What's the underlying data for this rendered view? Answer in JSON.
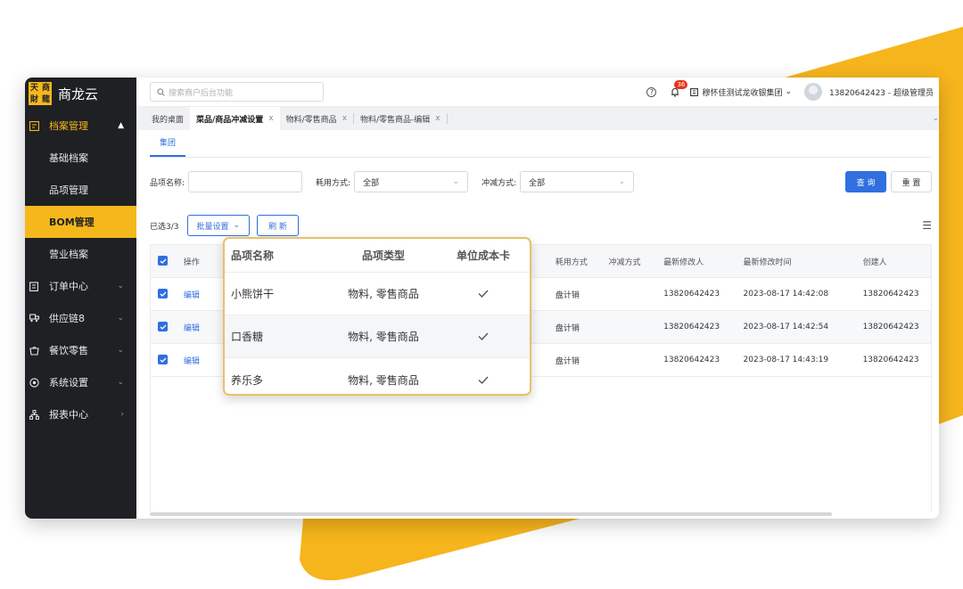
{
  "brand": {
    "logo_chars": [
      "天",
      "商",
      "財",
      "龍"
    ],
    "name": "商龙云"
  },
  "colors": {
    "accent": "#f5b81c",
    "primary": "#2f6fe0",
    "sidebar": "#1f2024",
    "badge": "#e8341c"
  },
  "sidebar": {
    "group": {
      "label": "档案管理",
      "icon": "archive-icon",
      "expanded": true
    },
    "subitems": [
      {
        "label": "基础档案",
        "active": false
      },
      {
        "label": "品项管理",
        "active": false
      },
      {
        "label": "BOM管理",
        "active": true
      },
      {
        "label": "营业档案",
        "active": false
      }
    ],
    "items": [
      {
        "label": "订单中心",
        "icon": "order-icon",
        "arrow": "chevron-down-icon"
      },
      {
        "label": "供应链8",
        "icon": "supply-chain-icon",
        "arrow": "chevron-down-icon"
      },
      {
        "label": "餐饮零售",
        "icon": "retail-icon",
        "arrow": "chevron-down-icon"
      },
      {
        "label": "系统设置",
        "icon": "settings-icon",
        "arrow": "chevron-down-icon"
      },
      {
        "label": "报表中心",
        "icon": "report-icon",
        "arrow": "chevron-right-icon"
      }
    ]
  },
  "topbar": {
    "search_placeholder": "搜索商户后台功能",
    "notification_count": "36",
    "org_name": "穆怀佳测试龙收银集团",
    "user": "13820642423 - 超级管理员"
  },
  "tabs": [
    {
      "label": "我的桌面",
      "active": false,
      "closable": false
    },
    {
      "label": "菜品/商品冲减设置",
      "active": true,
      "closable": true
    },
    {
      "label": "物料/零售商品",
      "active": false,
      "closable": true
    },
    {
      "label": "物料/零售商品-编辑",
      "active": false,
      "closable": true
    }
  ],
  "subtab": "集团",
  "filters": {
    "item_name_label": "品项名称:",
    "consumption_label": "耗用方式:",
    "consumption_value": "全部",
    "offset_label": "冲减方式:",
    "offset_value": "全部",
    "query_label": "查 询",
    "reset_label": "重 置"
  },
  "actions": {
    "selected_text": "已选3/3",
    "batch_label": "批量设置",
    "refresh_label": "刷 新"
  },
  "table": {
    "headers": {
      "op": "操作",
      "consumption": "耗用方式",
      "offset": "冲减方式",
      "modifier": "最新修改人",
      "mod_time": "最新修改时间",
      "creator": "创建人"
    },
    "rows": [
      {
        "checked": true,
        "op": "编辑",
        "consumption": "盘计销",
        "offset": "",
        "modifier": "13820642423",
        "mod_time": "2023-08-17 14:42:08",
        "creator": "13820642423"
      },
      {
        "checked": true,
        "op": "编辑",
        "consumption": "盘计销",
        "offset": "",
        "modifier": "13820642423",
        "mod_time": "2023-08-17 14:42:54",
        "creator": "13820642423"
      },
      {
        "checked": true,
        "op": "编辑",
        "consumption": "盘计销",
        "offset": "",
        "modifier": "13820642423",
        "mod_time": "2023-08-17 14:43:19",
        "creator": "13820642423"
      }
    ]
  },
  "popup": {
    "headers": {
      "name": "品项名称",
      "type": "品项类型",
      "card": "单位成本卡"
    },
    "rows": [
      {
        "name": "小熊饼干",
        "type": "物料, 零售商品",
        "card": true
      },
      {
        "name": "口香糖",
        "type": "物料, 零售商品",
        "card": true
      },
      {
        "name": "养乐多",
        "type": "物料, 零售商品",
        "card": true
      }
    ]
  }
}
